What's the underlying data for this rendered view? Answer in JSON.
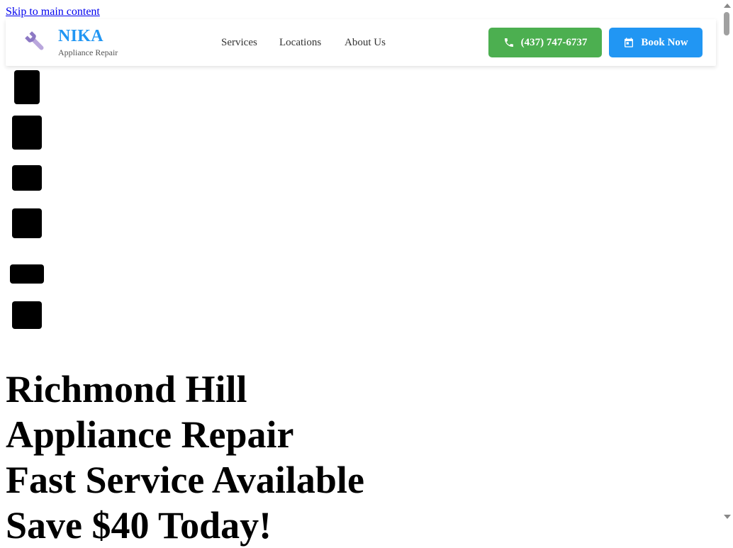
{
  "skip_link": "Skip to main content",
  "header": {
    "brand": "NIKA",
    "tagline": "Appliance Repair",
    "logo_icon": "wrench-icon",
    "nav": [
      "Services",
      "Locations",
      "About Us"
    ],
    "phone_label": "(437) 747-6737",
    "book_label": "Book Now",
    "call_color": "#4caf50",
    "book_color": "#2196f3",
    "brand_color": "#2196f3"
  },
  "hero": {
    "lines": [
      "Richmond Hill",
      "Appliance Repair",
      "Fast Service Available",
      "Save $40 Today!"
    ]
  }
}
